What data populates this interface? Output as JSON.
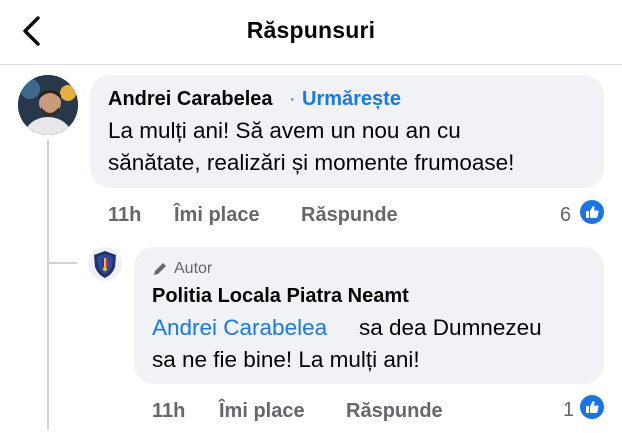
{
  "header": {
    "title": "Răspunsuri"
  },
  "comment": {
    "author": "Andrei Carabelea",
    "separator": "·",
    "follow_label": "Urmărește",
    "text_line1": "La mulți ani! Să avem un nou an cu",
    "text_line2": "sănătate, realizări și momente frumoase!",
    "time": "11h",
    "like_label": "Îmi place",
    "reply_label": "Răspunde",
    "reaction_count": "6"
  },
  "reply": {
    "badge_label": "Autor",
    "author": "Politia Locala Piatra Neamt",
    "mention": "Andrei Carabelea",
    "text_line1": "sa dea Dumnezeu",
    "text_line2": "sa ne fie bine! La mulți ani!",
    "time": "11h",
    "like_label": "Îmi place",
    "reply_label": "Răspunde",
    "reaction_count": "1"
  },
  "colors": {
    "link": "#1877f2",
    "bubble": "#f0f2f5",
    "meta": "#65676b"
  }
}
